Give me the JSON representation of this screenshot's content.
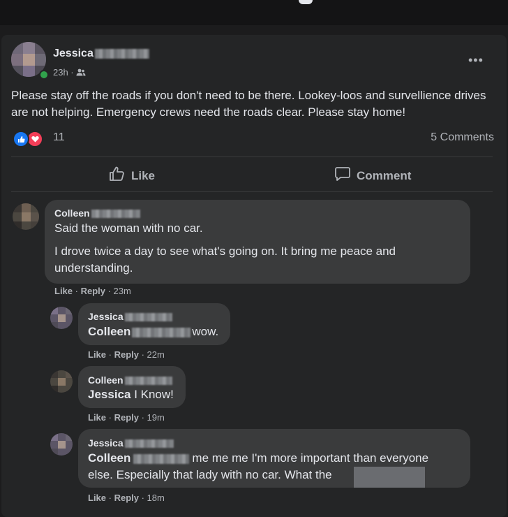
{
  "post": {
    "author_first": "Jessica",
    "time": "23h ·",
    "privacy_icon": "friends-icon",
    "more": "•••",
    "text": "Please stay off the roads if you don't need to be there. Lookey-loos and survellience drives are not helping. Emergency crews need the roads clear. Please stay home!",
    "reaction_count": "11",
    "comment_count": "5 Comments",
    "like_label": "Like",
    "comment_label": "Comment"
  },
  "comments": [
    {
      "name": "Colleen",
      "lines": [
        "Said the woman with no car.",
        "I drove twice a day to see what's going on. It bring me peace and understanding."
      ],
      "like": "Like",
      "reply": "Reply",
      "time": "· 23m"
    },
    {
      "name": "Jessica",
      "mention": "Colleen",
      "text": "wow.",
      "like": "Like",
      "reply": "Reply",
      "time": "· 22m"
    },
    {
      "name": "Colleen",
      "mention": "Jessica",
      "text": "I Know!",
      "like": "Like",
      "reply": "Reply",
      "time": "· 19m"
    },
    {
      "name": "Jessica",
      "mention": "Colleen",
      "text": "me me me I'm more important than everyone",
      "text2": "else. Especially that lady with no car. What the",
      "like": "Like",
      "reply": "Reply",
      "time": "· 18m"
    }
  ],
  "colors": {
    "background": "#1c1c1d",
    "card": "#242526",
    "bubble": "#3a3b3c",
    "like_blue": "#1877f2",
    "love_red": "#f33e58"
  }
}
